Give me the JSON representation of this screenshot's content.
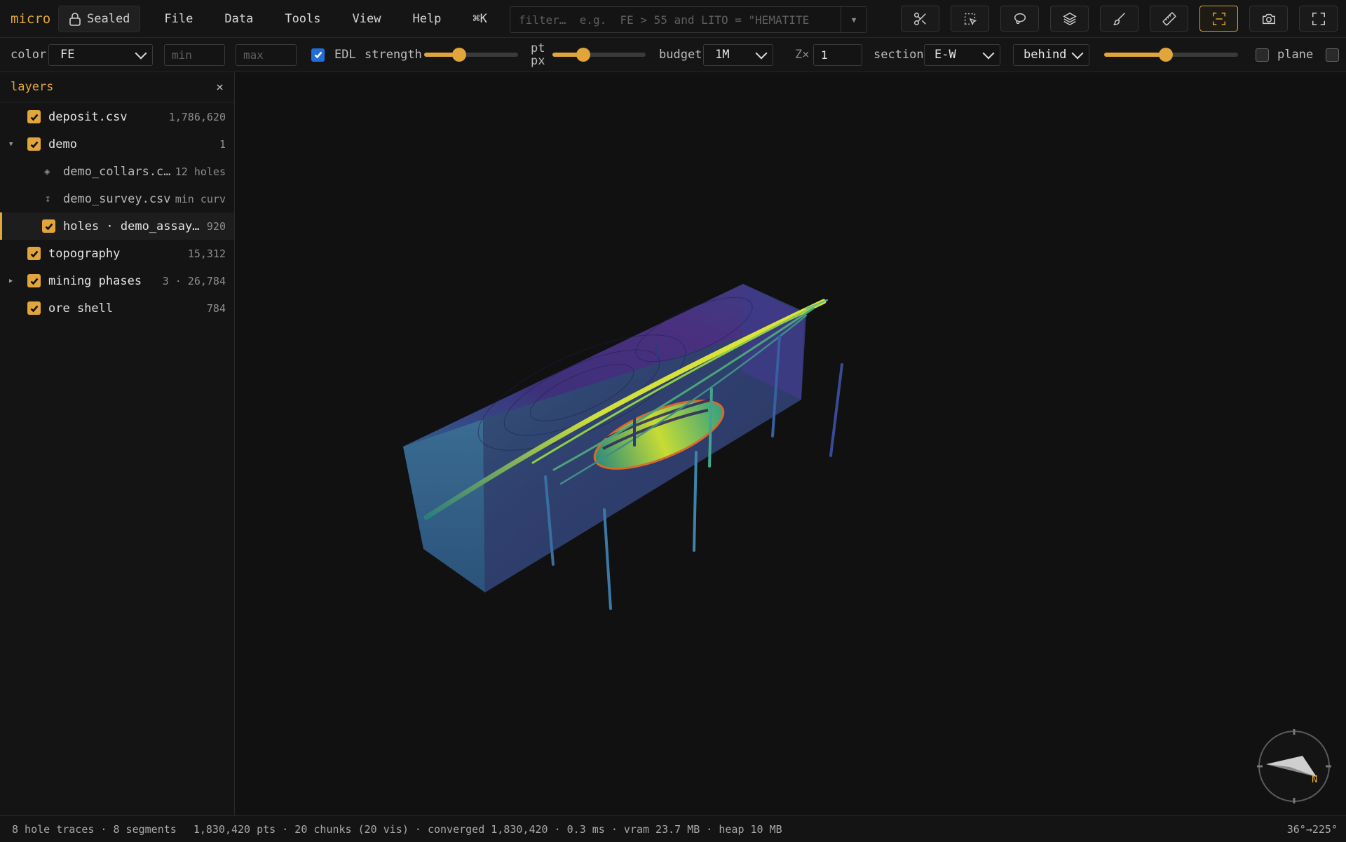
{
  "app": {
    "brand": "micro",
    "sealed_label": "Sealed"
  },
  "menu": [
    "File",
    "Data",
    "Tools",
    "View",
    "Help",
    "⌘K"
  ],
  "filter": {
    "placeholder": "filter…  e.g.  FE > 55 and LITO = \"HEMATITE"
  },
  "tools": [
    {
      "name": "clip-tool",
      "icon": "scissors-icon"
    },
    {
      "name": "box-select-tool",
      "icon": "box-select-icon"
    },
    {
      "name": "lasso-tool",
      "icon": "lasso-icon"
    },
    {
      "name": "layers-tool",
      "icon": "layers-stack-icon"
    },
    {
      "name": "paint-tool",
      "icon": "brush-icon"
    },
    {
      "name": "measure-tool",
      "icon": "ruler-icon"
    },
    {
      "name": "section-tool",
      "icon": "section-frame-icon",
      "active": true
    },
    {
      "name": "screenshot-tool",
      "icon": "camera-icon"
    },
    {
      "name": "fullscreen-tool",
      "icon": "fullscreen-icon"
    }
  ],
  "toolbar": {
    "color_label": "color",
    "color_value": "FE",
    "min_placeholder": "min",
    "max_placeholder": "max",
    "edl_label": "EDL",
    "edl_checked": true,
    "strength_label": "strength",
    "strength_level": 0.37,
    "ptpx_label_1": "pt",
    "ptpx_label_2": "px",
    "ptpx_level": 0.33,
    "budget_label": "budget",
    "budget_value": "1M",
    "z_label": "Z×",
    "z_value": "1",
    "section_label": "section",
    "section_value": "E-W",
    "mode_value": "behind",
    "section_level": 0.46,
    "plane_label": "plane",
    "plane_checked": false,
    "extra_checked": false
  },
  "layers": {
    "title": "layers",
    "close": "×",
    "items": [
      {
        "name": "deposit.csv",
        "count": "1,786,620",
        "checked": true
      },
      {
        "name": "demo",
        "count": "1",
        "checked": true,
        "expanded": true
      },
      {
        "name": "demo_collars.c…",
        "count": "12 holes",
        "icon": "◈"
      },
      {
        "name": "demo_survey.csv",
        "count": "min curv",
        "icon": "↧"
      },
      {
        "name": "holes · demo_assay…",
        "count": "920",
        "checked": true,
        "selected": true
      },
      {
        "name": "topography",
        "count": "15,312",
        "checked": true
      },
      {
        "name": "mining phases",
        "count": "3 · 26,784",
        "checked": true,
        "expanded": false
      },
      {
        "name": "ore shell",
        "count": "784",
        "checked": true
      }
    ]
  },
  "status": {
    "left": "8 hole traces · 8 segments",
    "middle": "1,830,420 pts · 20 chunks (20 vis) · converged 1,830,420 · 0.3 ms · vram 23.7 MB · heap 10 MB",
    "right": "36°→225°"
  },
  "compass": {
    "north": "N"
  },
  "colors": {
    "accent": "#e0a53b",
    "bg": "#111111"
  }
}
